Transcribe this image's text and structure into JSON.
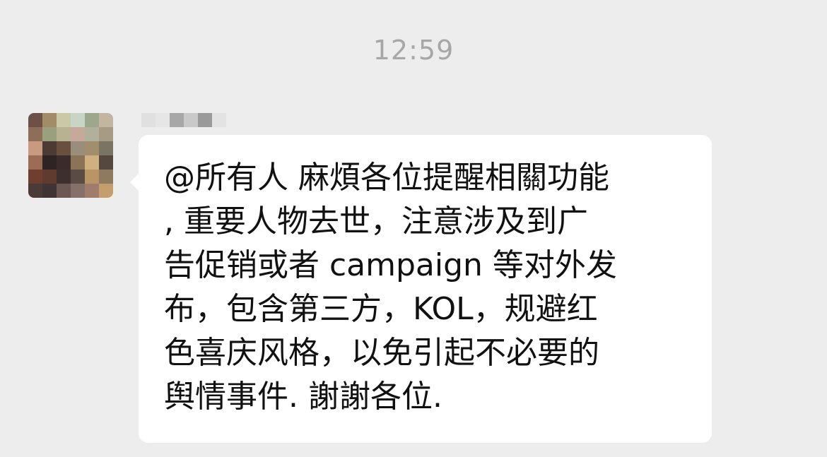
{
  "chat": {
    "timestamp": "12:59",
    "message": {
      "lines": [
        "@所有人 麻煩各位提醒相關功能",
        ", 重要人物去世，注意涉及到广",
        "告促销或者 campaign 等对外发",
        "布，包含第三方，KOL，规避红",
        "色喜庆风格，以免引起不必要的",
        "舆情事件. 謝謝各位."
      ]
    }
  },
  "colors": {
    "background": "#ededed",
    "bubble": "#ffffff",
    "timestamp_text": "#a7a7a7",
    "message_text": "#111111"
  }
}
